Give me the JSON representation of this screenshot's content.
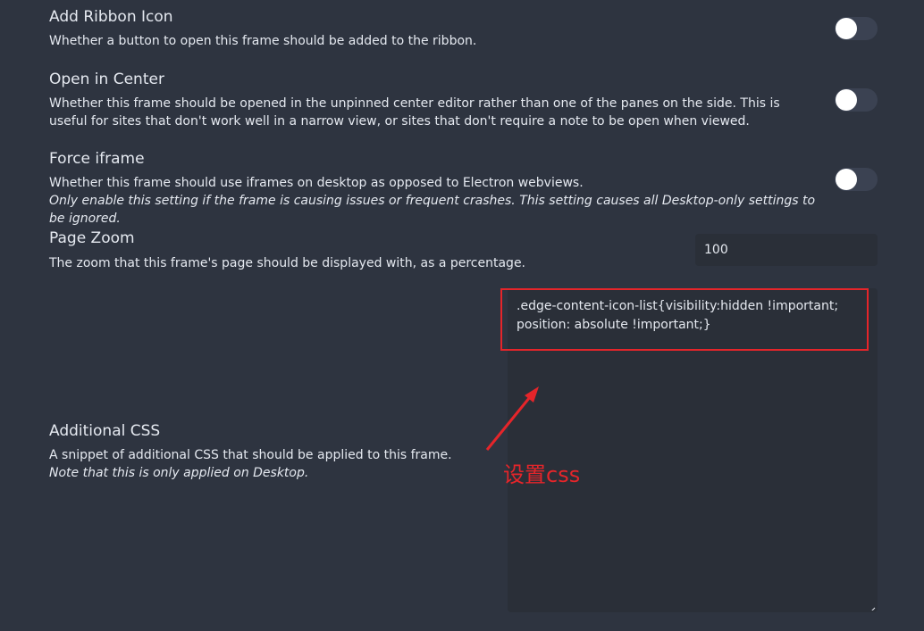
{
  "settings": {
    "ribbon_icon": {
      "name": "Add Ribbon Icon",
      "desc": "Whether a button to open this frame should be added to the ribbon.",
      "enabled": false
    },
    "open_center": {
      "name": "Open in Center",
      "desc": "Whether this frame should be opened in the unpinned center editor rather than one of the panes on the side. This is useful for sites that don't work well in a narrow view, or sites that don't require a note to be open when viewed.",
      "enabled": false
    },
    "force_iframe": {
      "name": "Force iframe",
      "desc": "Whether this frame should use iframes on desktop as opposed to Electron webviews.",
      "note": "Only enable this setting if the frame is causing issues or frequent crashes. This setting causes all Desktop-only settings to be ignored.",
      "enabled": false
    },
    "page_zoom": {
      "name": "Page Zoom",
      "desc": "The zoom that this frame's page should be displayed with, as a percentage.",
      "value": "100"
    },
    "additional_css": {
      "name": "Additional CSS",
      "desc": "A snippet of additional CSS that should be applied to this frame.",
      "note": "Note that this is only applied on Desktop.",
      "value": ".edge-content-icon-list{visibility:hidden !important; position: absolute !important;}"
    }
  },
  "annotation": {
    "label": "设置css",
    "color": "#e5252a"
  },
  "colors": {
    "background": "#2e3440",
    "input_background": "#2a2f38",
    "text": "#e5e9f0",
    "toggle_track": "#3b4252"
  }
}
